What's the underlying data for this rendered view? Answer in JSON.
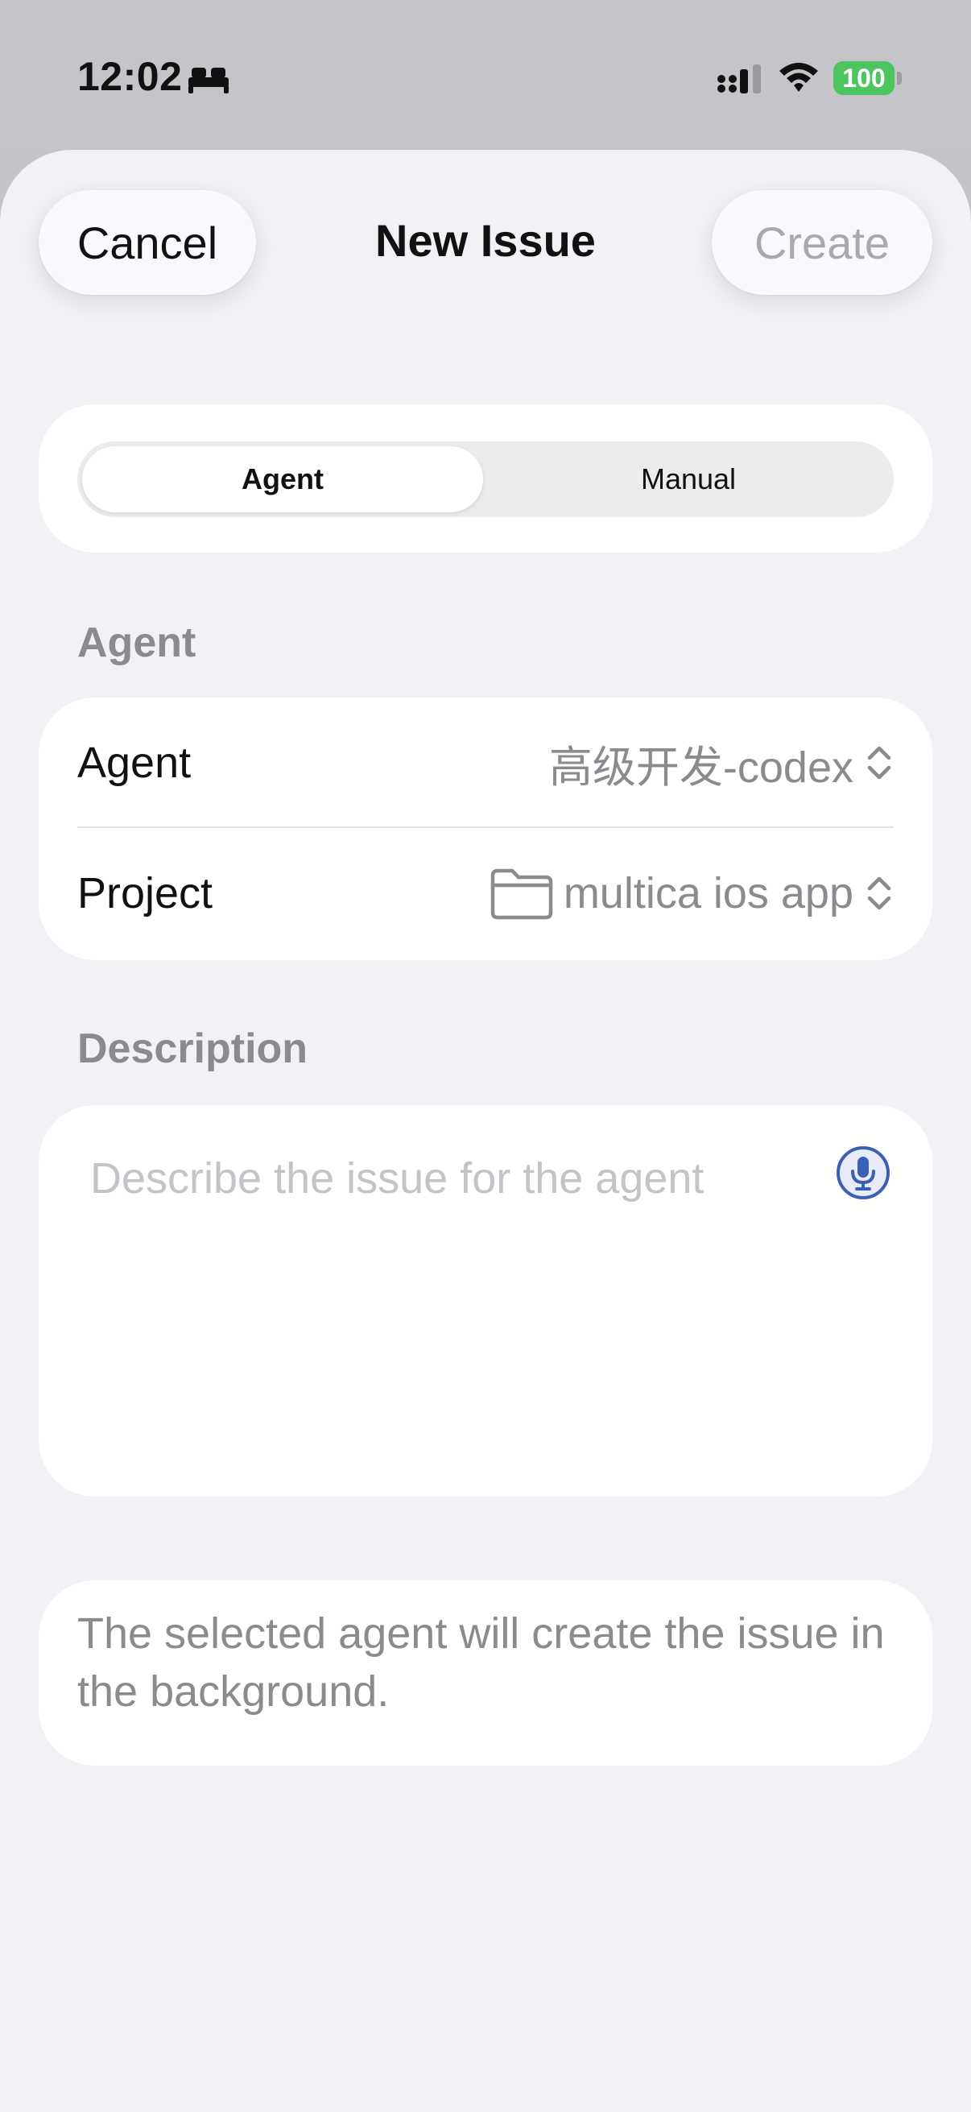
{
  "status_bar": {
    "time": "12:02",
    "battery_level": "100",
    "focus_icon": "bed-icon",
    "signal_icon": "cellular-signal-icon",
    "wifi_icon": "wifi-icon",
    "battery_color": "#4cc560"
  },
  "sheet": {
    "title": "New Issue",
    "cancel_label": "Cancel",
    "create_label": "Create"
  },
  "mode_toggle": {
    "options": [
      "Agent",
      "Manual"
    ],
    "selected": "Agent"
  },
  "agent_section": {
    "header": "Agent",
    "rows": [
      {
        "label": "Agent",
        "value": "高级开发-codex"
      },
      {
        "label": "Project",
        "value": "multica ios app",
        "icon": "folder-icon"
      }
    ]
  },
  "description_section": {
    "header": "Description",
    "placeholder": "Describe the issue for the agent",
    "mic_icon": "microphone-icon",
    "accent_color": "#3a5fb4"
  },
  "info": {
    "text": "The selected agent will create the issue in the background."
  }
}
